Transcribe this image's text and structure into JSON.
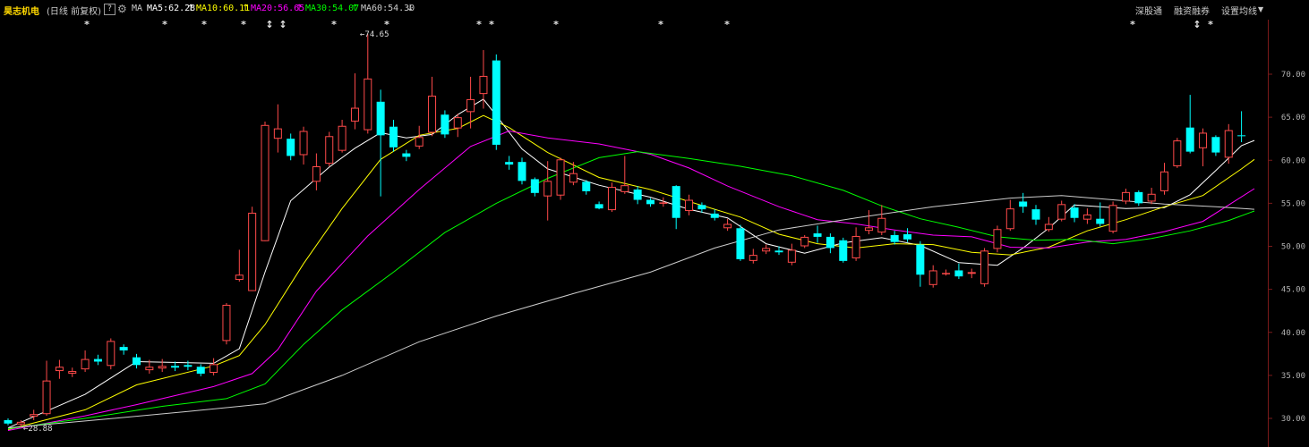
{
  "header": {
    "stock_name": "昊志机电",
    "mode": "(日线 前复权)",
    "help": "?",
    "indicator": "MA",
    "ma5": "MA5:62.28",
    "ma10": "MA10:60.11",
    "ma20": "MA20:56.65",
    "ma30": "MA30:54.07",
    "ma60": "MA60:54.30",
    "link1": "深股通",
    "link2": "融资融券",
    "link3": "设置均线"
  },
  "colors": {
    "up": "#ff4a4a",
    "down": "#00ffff",
    "ma5": "#ffffff",
    "ma10": "#ffff00",
    "ma20": "#ff00ff",
    "ma30": "#00ff00",
    "ma60": "#cccccc",
    "axis": "#7a1a1a"
  },
  "annotations": {
    "high_label": "74.65",
    "low_label": "28.88"
  },
  "chart_data": {
    "type": "candlestick",
    "y_ticks": [
      "70.00",
      "65.00",
      "60.00",
      "55.00",
      "50.00",
      "45.00",
      "40.00",
      "35.00",
      "30.00"
    ],
    "ylim": [
      28.0,
      75.5
    ],
    "candles": [
      [
        29.8,
        29.4,
        30.0,
        29.2
      ],
      [
        29.3,
        29.6,
        29.8,
        29.0
      ],
      [
        30.2,
        30.5,
        31.0,
        29.8
      ],
      [
        30.5,
        34.4,
        36.7,
        30.3
      ],
      [
        35.5,
        36.0,
        36.8,
        34.6
      ],
      [
        35.2,
        35.5,
        35.9,
        34.8
      ],
      [
        35.7,
        36.9,
        37.9,
        35.4
      ],
      [
        36.9,
        36.6,
        37.4,
        36.2
      ],
      [
        36.1,
        39.0,
        39.3,
        35.7
      ],
      [
        38.3,
        37.9,
        38.6,
        37.4
      ],
      [
        37.1,
        36.2,
        37.5,
        35.8
      ],
      [
        35.6,
        36.0,
        36.8,
        35.2
      ],
      [
        35.8,
        36.1,
        36.9,
        35.4
      ],
      [
        36.1,
        35.9,
        36.6,
        35.5
      ],
      [
        36.2,
        36.0,
        36.7,
        35.6
      ],
      [
        36.0,
        35.2,
        36.3,
        34.9
      ],
      [
        35.3,
        36.3,
        37.0,
        35.0
      ],
      [
        39.0,
        43.2,
        43.4,
        38.6
      ],
      [
        46.1,
        46.7,
        49.6,
        45.9
      ],
      [
        44.8,
        53.9,
        54.6,
        44.8
      ],
      [
        50.6,
        64.1,
        64.5,
        50.6
      ],
      [
        62.5,
        63.7,
        66.5,
        60.9
      ],
      [
        62.5,
        60.5,
        63.1,
        60.0
      ],
      [
        60.6,
        63.4,
        63.9,
        59.5
      ],
      [
        57.5,
        59.3,
        60.8,
        56.5
      ],
      [
        59.6,
        62.8,
        63.3,
        59.3
      ],
      [
        61.1,
        64.0,
        64.7,
        60.9
      ],
      [
        64.5,
        66.1,
        70.1,
        63.6
      ],
      [
        63.5,
        69.5,
        74.65,
        63.1
      ],
      [
        66.8,
        62.9,
        68.2,
        55.8
      ],
      [
        63.9,
        61.5,
        64.7,
        61.0
      ],
      [
        60.8,
        60.4,
        61.2,
        59.9
      ],
      [
        61.6,
        62.7,
        64.0,
        61.3
      ],
      [
        63.2,
        67.5,
        69.7,
        62.8
      ],
      [
        65.3,
        63.0,
        65.8,
        62.6
      ],
      [
        63.7,
        65.0,
        65.4,
        62.7
      ],
      [
        65.6,
        67.1,
        69.7,
        63.7
      ],
      [
        67.7,
        69.8,
        72.8,
        66.0
      ],
      [
        71.6,
        61.8,
        72.3,
        61.2
      ],
      [
        59.8,
        59.5,
        60.5,
        58.9
      ],
      [
        59.8,
        57.6,
        60.3,
        57.2
      ],
      [
        57.8,
        56.2,
        58.0,
        55.8
      ],
      [
        55.8,
        57.6,
        59.9,
        53.0
      ],
      [
        55.9,
        60.1,
        60.3,
        55.4
      ],
      [
        57.4,
        58.5,
        59.8,
        57.1
      ],
      [
        57.5,
        56.4,
        57.7,
        56.0
      ],
      [
        54.9,
        54.4,
        55.2,
        54.3
      ],
      [
        54.2,
        56.9,
        57.4,
        54.0
      ],
      [
        56.3,
        57.1,
        60.5,
        56.1
      ],
      [
        56.6,
        55.4,
        57.0,
        54.9
      ],
      [
        55.4,
        54.9,
        55.6,
        54.6
      ],
      [
        55.0,
        55.1,
        55.7,
        54.6
      ],
      [
        57.0,
        53.3,
        57.1,
        52.0
      ],
      [
        54.1,
        55.4,
        56.0,
        53.6
      ],
      [
        54.8,
        54.3,
        55.1,
        53.9
      ],
      [
        53.8,
        53.3,
        54.3,
        53.0
      ],
      [
        52.1,
        52.6,
        53.2,
        51.8
      ],
      [
        52.1,
        48.5,
        52.5,
        48.3
      ],
      [
        48.3,
        49.0,
        49.7,
        48.0
      ],
      [
        49.4,
        49.8,
        50.2,
        49.1
      ],
      [
        49.5,
        49.3,
        50.0,
        49.0
      ],
      [
        48.1,
        49.6,
        50.3,
        47.8
      ],
      [
        50.0,
        51.1,
        51.3,
        49.8
      ],
      [
        51.5,
        51.1,
        52.4,
        50.4
      ],
      [
        51.1,
        49.8,
        51.5,
        49.2
      ],
      [
        50.7,
        48.3,
        51.0,
        48.1
      ],
      [
        48.6,
        51.2,
        52.2,
        48.3
      ],
      [
        51.8,
        52.2,
        54.2,
        51.4
      ],
      [
        51.6,
        53.3,
        54.8,
        51.3
      ],
      [
        51.3,
        50.5,
        51.8,
        50.2
      ],
      [
        51.4,
        50.8,
        52.1,
        50.5
      ],
      [
        50.2,
        46.7,
        50.6,
        45.3
      ],
      [
        45.5,
        47.2,
        47.8,
        45.2
      ],
      [
        46.8,
        46.9,
        47.3,
        46.6
      ],
      [
        47.2,
        46.5,
        48.0,
        46.2
      ],
      [
        46.8,
        47.0,
        47.4,
        46.3
      ],
      [
        45.6,
        49.5,
        49.8,
        45.3
      ],
      [
        49.7,
        52.0,
        52.4,
        49.3
      ],
      [
        52.0,
        54.4,
        55.4,
        51.8
      ],
      [
        55.2,
        54.6,
        56.2,
        53.9
      ],
      [
        54.3,
        53.1,
        54.8,
        52.5
      ],
      [
        51.9,
        52.6,
        53.4,
        51.7
      ],
      [
        53.1,
        54.9,
        55.3,
        52.9
      ],
      [
        54.5,
        53.3,
        54.9,
        52.8
      ],
      [
        53.1,
        53.7,
        54.4,
        52.6
      ],
      [
        53.2,
        52.6,
        55.1,
        52.3
      ],
      [
        51.7,
        54.8,
        55.2,
        51.5
      ],
      [
        55.2,
        56.3,
        56.7,
        54.9
      ],
      [
        56.3,
        55.0,
        56.5,
        54.7
      ],
      [
        55.2,
        56.1,
        56.8,
        54.9
      ],
      [
        56.4,
        58.7,
        59.7,
        56.0
      ],
      [
        59.3,
        62.3,
        62.6,
        59.1
      ],
      [
        63.8,
        61.0,
        67.6,
        60.8
      ],
      [
        61.4,
        63.2,
        63.7,
        59.3
      ],
      [
        62.7,
        60.9,
        62.9,
        60.5
      ],
      [
        60.3,
        63.5,
        64.2,
        59.6
      ],
      [
        62.9,
        62.8,
        65.7,
        62.1
      ]
    ],
    "ma_series": [
      {
        "name": "MA5",
        "color": "#ffffff",
        "points": [
          [
            0,
            28.9
          ],
          [
            6,
            32.8
          ],
          [
            10,
            36.6
          ],
          [
            16,
            36.4
          ],
          [
            18,
            38.1
          ],
          [
            20,
            47.0
          ],
          [
            22,
            55.3
          ],
          [
            25,
            59.2
          ],
          [
            27,
            61.4
          ],
          [
            29,
            63.2
          ],
          [
            31,
            62.6
          ],
          [
            33,
            63.0
          ],
          [
            35,
            65.3
          ],
          [
            37,
            67.1
          ],
          [
            38,
            65.2
          ],
          [
            40,
            61.3
          ],
          [
            42,
            59.0
          ],
          [
            46,
            57.1
          ],
          [
            50,
            55.7
          ],
          [
            53,
            54.3
          ],
          [
            56,
            53.3
          ],
          [
            59,
            50.3
          ],
          [
            62,
            49.2
          ],
          [
            65,
            50.4
          ],
          [
            68,
            51.0
          ],
          [
            71,
            50.1
          ],
          [
            74,
            48.1
          ],
          [
            77,
            47.8
          ],
          [
            79,
            49.8
          ],
          [
            81,
            52.1
          ],
          [
            83,
            54.8
          ],
          [
            87,
            54.4
          ],
          [
            90,
            54.5
          ],
          [
            92,
            56.0
          ],
          [
            94,
            58.8
          ],
          [
            96,
            61.7
          ],
          [
            97,
            62.3
          ]
        ]
      },
      {
        "name": "MA10",
        "color": "#ffff00",
        "points": [
          [
            0,
            28.7
          ],
          [
            6,
            31.0
          ],
          [
            10,
            33.9
          ],
          [
            16,
            36.1
          ],
          [
            18,
            37.3
          ],
          [
            20,
            40.9
          ],
          [
            23,
            48.0
          ],
          [
            26,
            54.4
          ],
          [
            29,
            60.1
          ],
          [
            32,
            62.9
          ],
          [
            35,
            63.7
          ],
          [
            37,
            65.2
          ],
          [
            39,
            63.8
          ],
          [
            42,
            60.9
          ],
          [
            46,
            58.0
          ],
          [
            50,
            56.6
          ],
          [
            53,
            55.2
          ],
          [
            57,
            53.4
          ],
          [
            60,
            51.4
          ],
          [
            63,
            50.3
          ],
          [
            66,
            49.8
          ],
          [
            69,
            50.3
          ],
          [
            72,
            50.2
          ],
          [
            75,
            49.3
          ],
          [
            78,
            49.0
          ],
          [
            81,
            49.9
          ],
          [
            84,
            51.8
          ],
          [
            87,
            53.1
          ],
          [
            90,
            54.6
          ],
          [
            93,
            55.9
          ],
          [
            96,
            59.0
          ],
          [
            97,
            60.1
          ]
        ]
      },
      {
        "name": "MA20",
        "color": "#ff00ff",
        "points": [
          [
            0,
            28.6
          ],
          [
            6,
            30.3
          ],
          [
            10,
            31.6
          ],
          [
            16,
            33.7
          ],
          [
            19,
            35.2
          ],
          [
            21,
            38.0
          ],
          [
            24,
            44.8
          ],
          [
            28,
            51.2
          ],
          [
            32,
            56.6
          ],
          [
            36,
            61.6
          ],
          [
            39,
            63.4
          ],
          [
            42,
            62.6
          ],
          [
            46,
            61.9
          ],
          [
            50,
            60.7
          ],
          [
            53,
            59.1
          ],
          [
            56,
            57.0
          ],
          [
            60,
            54.6
          ],
          [
            63,
            53.1
          ],
          [
            66,
            52.6
          ],
          [
            69,
            51.9
          ],
          [
            72,
            51.3
          ],
          [
            75,
            51.1
          ],
          [
            78,
            49.9
          ],
          [
            81,
            49.8
          ],
          [
            84,
            50.5
          ],
          [
            87,
            50.8
          ],
          [
            90,
            51.7
          ],
          [
            93,
            52.9
          ],
          [
            97,
            56.7
          ]
        ]
      },
      {
        "name": "MA30",
        "color": "#00ff00",
        "points": [
          [
            0,
            28.8
          ],
          [
            6,
            30.0
          ],
          [
            12,
            31.4
          ],
          [
            17,
            32.3
          ],
          [
            20,
            34.0
          ],
          [
            23,
            38.6
          ],
          [
            26,
            42.6
          ],
          [
            30,
            47.0
          ],
          [
            34,
            51.6
          ],
          [
            38,
            55.0
          ],
          [
            42,
            57.9
          ],
          [
            46,
            60.3
          ],
          [
            49,
            61.0
          ],
          [
            53,
            60.2
          ],
          [
            57,
            59.3
          ],
          [
            61,
            58.2
          ],
          [
            65,
            56.5
          ],
          [
            68,
            54.7
          ],
          [
            71,
            53.2
          ],
          [
            74,
            52.2
          ],
          [
            77,
            51.1
          ],
          [
            80,
            50.7
          ],
          [
            83,
            50.8
          ],
          [
            86,
            50.3
          ],
          [
            89,
            50.9
          ],
          [
            92,
            51.8
          ],
          [
            95,
            53.0
          ],
          [
            97,
            54.1
          ]
        ]
      },
      {
        "name": "MA60",
        "color": "#cccccc",
        "points": [
          [
            0,
            28.9
          ],
          [
            6,
            29.7
          ],
          [
            14,
            30.8
          ],
          [
            20,
            31.7
          ],
          [
            26,
            35.0
          ],
          [
            32,
            38.9
          ],
          [
            38,
            41.9
          ],
          [
            44,
            44.5
          ],
          [
            50,
            47.0
          ],
          [
            55,
            49.8
          ],
          [
            60,
            51.9
          ],
          [
            66,
            53.3
          ],
          [
            72,
            54.6
          ],
          [
            78,
            55.6
          ],
          [
            82,
            55.9
          ],
          [
            86,
            55.4
          ],
          [
            90,
            54.9
          ],
          [
            94,
            54.6
          ],
          [
            97,
            54.3
          ]
        ]
      }
    ],
    "markers": [
      {
        "x": 97,
        "sym": "*"
      },
      {
        "x": 184,
        "sym": "*"
      },
      {
        "x": 228,
        "sym": "*"
      },
      {
        "x": 272,
        "sym": "*"
      },
      {
        "x": 301,
        "sym": "↕"
      },
      {
        "x": 316,
        "sym": "↕"
      },
      {
        "x": 373,
        "sym": "*"
      },
      {
        "x": 432,
        "sym": "*"
      },
      {
        "x": 535,
        "sym": "*"
      },
      {
        "x": 549,
        "sym": "*"
      },
      {
        "x": 621,
        "sym": "*"
      },
      {
        "x": 738,
        "sym": "*"
      },
      {
        "x": 812,
        "sym": "*"
      },
      {
        "x": 1265,
        "sym": "*"
      },
      {
        "x": 1337,
        "sym": "↕"
      },
      {
        "x": 1352,
        "sym": "*"
      }
    ]
  }
}
